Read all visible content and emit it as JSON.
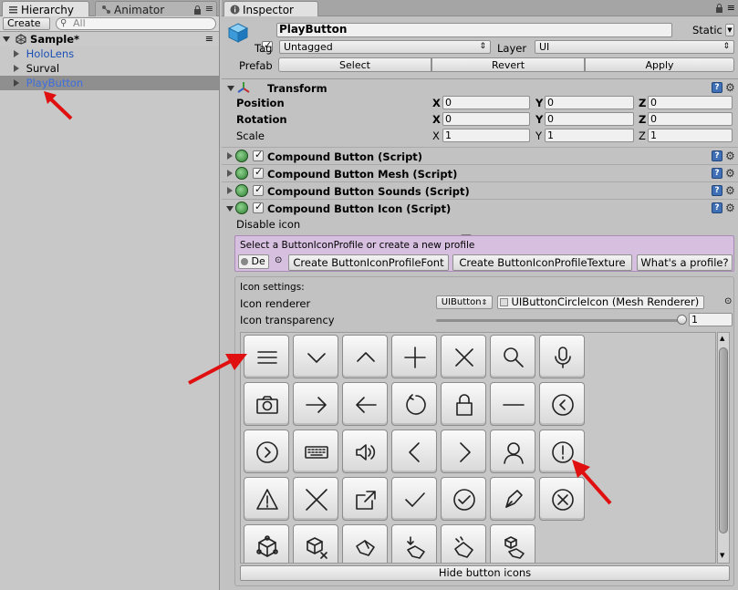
{
  "hierarchy": {
    "tab_label": "Hierarchy",
    "second_tab_label": "Animator",
    "create_label": "Create",
    "search_placeholder": "All",
    "scene_name": "Sample*",
    "items": [
      {
        "label": "HoloLens",
        "color": "#1a4fb5"
      },
      {
        "label": "Surval",
        "color": "#000000"
      },
      {
        "label": "PlayButton",
        "color": "#1a4fb5",
        "selected": true
      }
    ]
  },
  "inspector": {
    "tab_label": "Inspector",
    "object_name": "PlayButton",
    "static_label": "Static",
    "tag_label": "Tag",
    "tag_value": "Untagged",
    "layer_label": "Layer",
    "layer_value": "UI",
    "prefab_label": "Prefab",
    "prefab_buttons": [
      "Select",
      "Revert",
      "Apply"
    ],
    "transform": {
      "title": "Transform",
      "rows": [
        {
          "label": "Position",
          "bold": true,
          "x": "0",
          "y": "0",
          "z": "0"
        },
        {
          "label": "Rotation",
          "bold": true,
          "x": "0",
          "y": "0",
          "z": "0"
        },
        {
          "label": "Scale",
          "bold": false,
          "x": "1",
          "y": "1",
          "z": "1"
        }
      ],
      "axis_labels": [
        "X",
        "Y",
        "Z"
      ]
    },
    "components": [
      "Compound Button (Script)",
      "Compound Button Mesh (Script)",
      "Compound Button Sounds (Script)",
      "Compound Button Icon (Script)"
    ],
    "disable_icon_label": "Disable icon",
    "profile_hint": "Select a ButtonIconProfile or create a new profile",
    "profile_field": "De",
    "profile_buttons": [
      "Create ButtonIconProfileFont",
      "Create ButtonIconProfileTexture",
      "What's a profile?"
    ],
    "icon_settings_label": "Icon settings:",
    "icon_renderer_label": "Icon renderer",
    "icon_renderer_type": "UIButton",
    "icon_renderer_value": "UIButtonCircleIcon (Mesh Renderer)",
    "icon_transparency_label": "Icon transparency",
    "icon_transparency_value": "1",
    "transparency_level": 1.0,
    "hide_icons_label": "Hide button icons",
    "icons": [
      [
        "hamburger",
        "chevron-down",
        "chevron-up",
        "plus",
        "close",
        "search",
        "microphone"
      ],
      [
        "camera",
        "arrow-right",
        "arrow-left",
        "refresh",
        "lock",
        "minus",
        "circle-chevron-left"
      ],
      [
        "circle-chevron-right",
        "keyboard",
        "speaker",
        "angle-left",
        "angle-right",
        "person",
        "circle-exclamation"
      ],
      [
        "warning",
        "big-x",
        "share",
        "check",
        "circle-check",
        "pen",
        "circle-x"
      ],
      [
        "cube-network",
        "cube-remove",
        "hand-one",
        "hand-tap",
        "hand-drag",
        "cube-hand"
      ]
    ]
  },
  "colors": {
    "selected_row": "#8f8f8f",
    "profile_box": "#d7bfe0",
    "help_icon": "#3f6fb5",
    "annotation_arrow": "#e01010"
  }
}
